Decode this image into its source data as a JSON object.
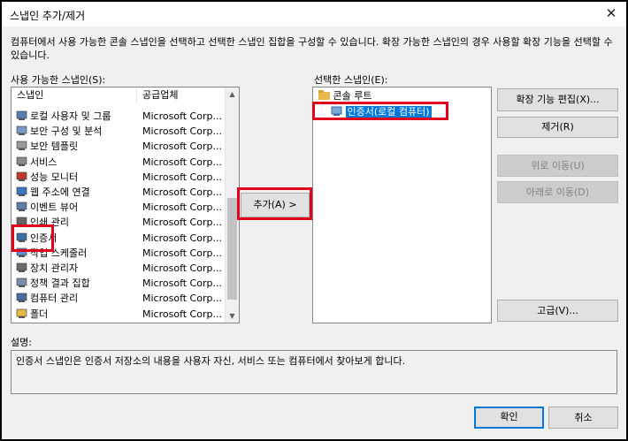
{
  "window": {
    "title": "스냅인 추가/제거",
    "close_glyph": "✕"
  },
  "description_top": "컴퓨터에서 사용 가능한 콘솔 스냅인을 선택하고 선택한 스냅인 집합을 구성할 수 있습니다. 확장 가능한 스냅인의 경우 사용할 확장 기능을 선택할 수 있습니다.",
  "available": {
    "label": "사용 가능한 스냅인(S):",
    "col_snapin": "스냅인",
    "col_vendor": "공급업체",
    "items": [
      {
        "name": "로컬 사용자 및 그룹",
        "vendor": "Microsoft Corp...",
        "icon": "users-icon"
      },
      {
        "name": "보안 구성 및 분석",
        "vendor": "Microsoft Corp...",
        "icon": "security-config-icon"
      },
      {
        "name": "보안 템플릿",
        "vendor": "Microsoft Corp...",
        "icon": "template-icon"
      },
      {
        "name": "서비스",
        "vendor": "Microsoft Corp...",
        "icon": "gear-icon"
      },
      {
        "name": "성능 모니터",
        "vendor": "Microsoft Corp...",
        "icon": "performance-icon"
      },
      {
        "name": "웹 주소에 연결",
        "vendor": "Microsoft Corp...",
        "icon": "web-icon"
      },
      {
        "name": "이벤트 뷰어",
        "vendor": "Microsoft Corp...",
        "icon": "event-viewer-icon"
      },
      {
        "name": "인쇄 관리",
        "vendor": "Microsoft Corp...",
        "icon": "printer-icon"
      },
      {
        "name": "인증서",
        "vendor": "Microsoft Corp...",
        "icon": "certificate-icon"
      },
      {
        "name": "작업 스케줄러",
        "vendor": "Microsoft Corp...",
        "icon": "scheduler-icon"
      },
      {
        "name": "장치 관리자",
        "vendor": "Microsoft Corp...",
        "icon": "device-manager-icon"
      },
      {
        "name": "정책 결과 집합",
        "vendor": "Microsoft Corp...",
        "icon": "policy-icon"
      },
      {
        "name": "컴퓨터 관리",
        "vendor": "Microsoft Corp...",
        "icon": "computer-icon"
      },
      {
        "name": "폴더",
        "vendor": "Microsoft Corp...",
        "icon": "folder-icon"
      }
    ]
  },
  "add_button": "추가(A) >",
  "selected": {
    "label": "선택한 스냅인(E):",
    "root": "콘솔 루트",
    "child": "인증서(로컬 컴퓨터)"
  },
  "buttons": {
    "edit_ext": "확장 기능 편집(X)...",
    "remove": "제거(R)",
    "move_up": "위로 이동(U)",
    "move_down": "아래로 이동(D)",
    "advanced": "고급(V)...",
    "ok": "확인",
    "cancel": "취소"
  },
  "description": {
    "label": "설명:",
    "text": "인증서 스냅인은 인증서 저장소의 내용을 사용자 자신, 서비스 또는 컴퓨터에서 찾아보게 합니다."
  },
  "colors": {
    "accent": "#0078d7",
    "highlight_box": "#e0001b",
    "folder": "#e8b84a"
  }
}
